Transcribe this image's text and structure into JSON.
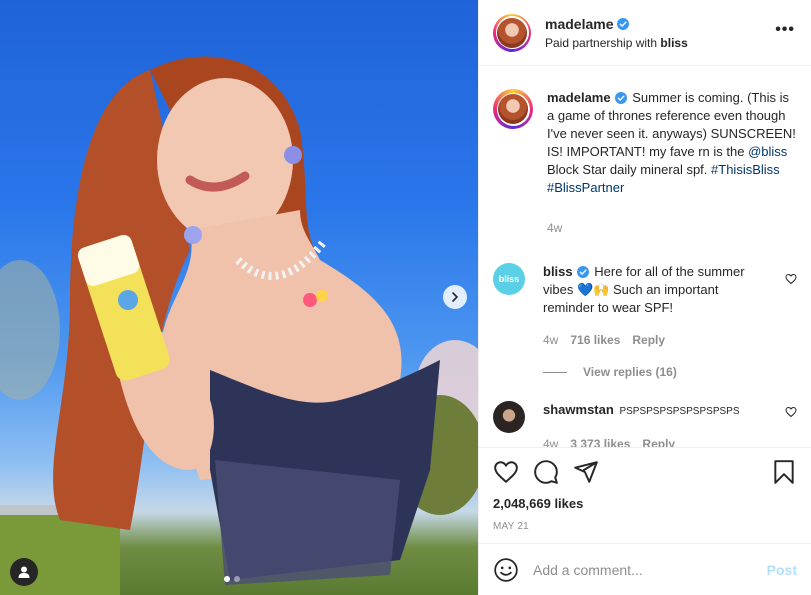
{
  "post": {
    "media": {
      "image_alt": "",
      "carousel_dots": 2,
      "active_dot": 0
    },
    "header": {
      "username": "madelame",
      "subtitle_prefix": "Paid partnership with",
      "partner": "bliss",
      "more_icon": "more-dots-icon",
      "more_label": "•••"
    },
    "caption": {
      "username": "madelame",
      "text_before": "Summer is coming. (This is a game of thrones reference even though I've never seen it. anyways) SUNSCREEN! IS! IMPORTANT! my fave rn is the",
      "mention": "@bliss",
      "text_after": "Block Star daily mineral spf.",
      "hashtag1": "#ThisisBliss",
      "hashtag2": "#BlissPartner",
      "age": "4w"
    },
    "comments": [
      {
        "username": "bliss",
        "avatar_label": "bliss",
        "text": "Here for all of the summer vibes 💙🙌 Such an important reminder to wear SPF!",
        "age": "4w",
        "likes": "716 likes",
        "reply": "Reply",
        "view_replies": "View replies (16)"
      },
      {
        "username": "shawmstan",
        "text": "PSPSPSPSPSPSPSPSPS",
        "age": "4w",
        "likes": "3 373 likes",
        "reply": "Reply"
      }
    ],
    "actions": {
      "likes_count": "2,048,669 likes",
      "date": "MAY 21"
    },
    "add_comment": {
      "placeholder": "Add a comment...",
      "post_label": "Post"
    }
  },
  "colors": {
    "link": "#00376b",
    "verified": "#3897f0",
    "post_button_disabled": "#b2dffc",
    "muted": "#8e8e8e"
  }
}
